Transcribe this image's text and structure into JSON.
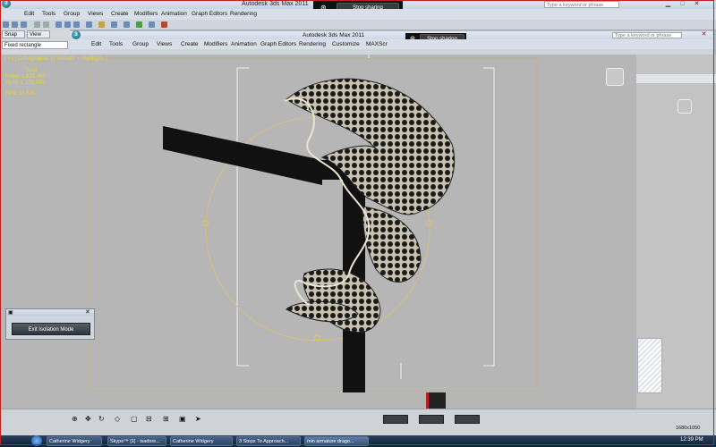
{
  "outer_window": {
    "title": "Autodesk 3ds Max  2011",
    "search_placeholder": "Type a keyword or phrase",
    "menu": [
      "Edit",
      "Tools",
      "Group",
      "Views",
      "Create",
      "Modifiers",
      "Animation",
      "Graph Editors",
      "Rendering"
    ]
  },
  "screen_share": {
    "button_label": "Stop sharing",
    "button_label_2": "Stop sharing"
  },
  "inner_window": {
    "title": "Autodesk 3ds Max  2011",
    "search_placeholder": "Type a keyword or phrase",
    "menu": [
      "Edit",
      "Tools",
      "Group",
      "Views",
      "Create",
      "Modifiers",
      "Animation",
      "Graph Editors",
      "Rendering",
      "Customize",
      "MAXScr"
    ]
  },
  "command_panel": {
    "snap_label": "Snap",
    "view_label": "View",
    "selection_label": "Fixed rectangle"
  },
  "viewport": {
    "label": "[ + ] [ Orthographic ] [ Smooth + Highlights ]",
    "stats_header": "Total",
    "polys_label": "Polys:",
    "polys_value": "1,629,060",
    "verts_label": "Verts:",
    "verts_value": "1,103,040",
    "fps_label": "FPS:",
    "fps_value": "14.826"
  },
  "isolation_dialog": {
    "button_label": "Exit Isolation Mode"
  },
  "taskbar": {
    "items": [
      "Catherine Widgery",
      "Skype™ [1] - isadore...",
      "Catherine Widgery",
      "3 Steps To Approach...",
      "min armature drago..."
    ],
    "clock": "12:39 PM"
  },
  "status": {
    "resolution": "1680x1050"
  },
  "colors": {
    "viewport_bg": "#b6b6b6",
    "stats_text": "#e8d23a",
    "frame_red": "#c0201f"
  }
}
